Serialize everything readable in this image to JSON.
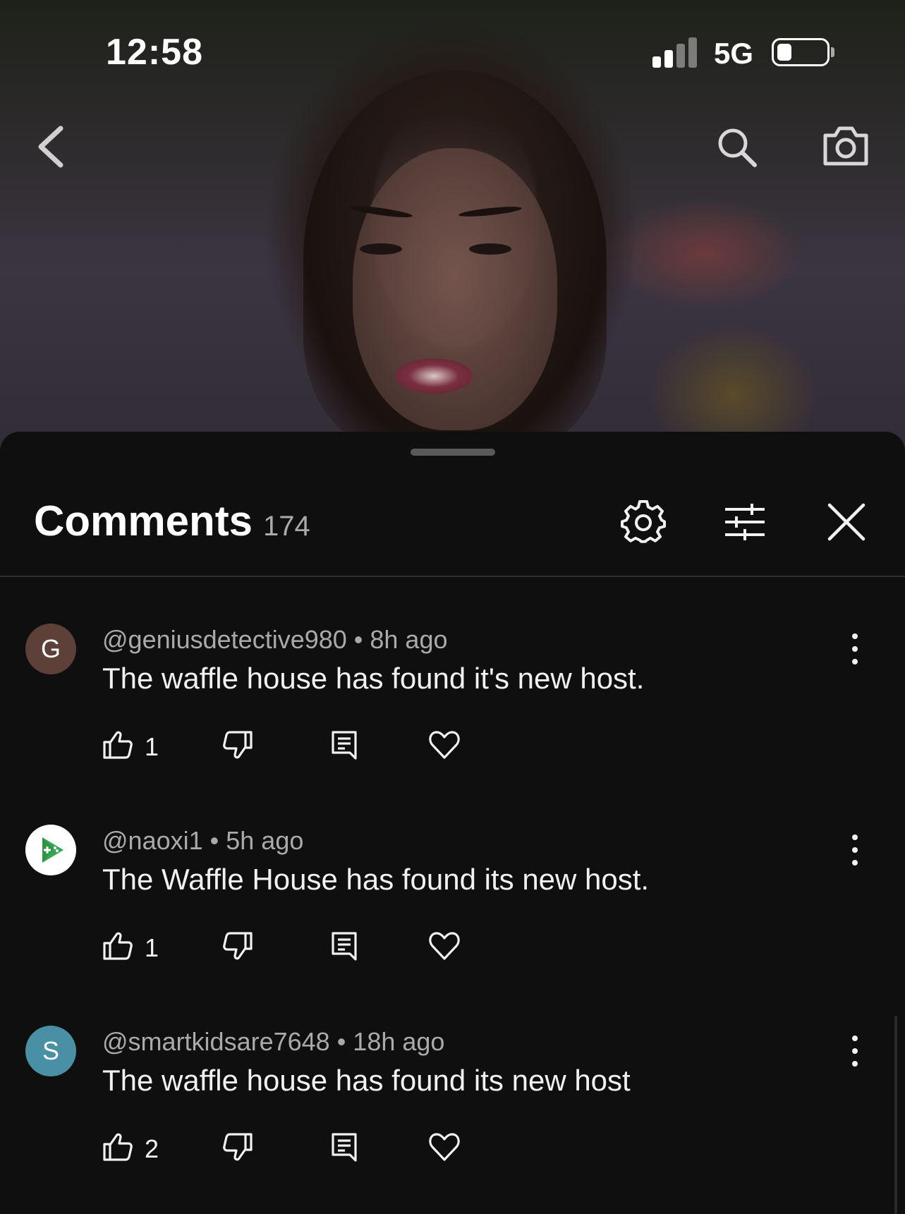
{
  "status_bar": {
    "time": "12:58",
    "network": "5G",
    "signal_bars_active": 2,
    "signal_bars_total": 4,
    "battery_level": 0.3
  },
  "video_header": {
    "back_icon": "chevron-left-icon",
    "search_icon": "search-icon",
    "camera_icon": "camera-icon"
  },
  "comments_panel": {
    "title": "Comments",
    "count": "174",
    "icons": [
      "gear-icon",
      "filter-sliders-icon",
      "close-icon"
    ]
  },
  "comments": [
    {
      "avatar_letter": "G",
      "avatar_color": "#5d4037",
      "author": "@geniusdetective980",
      "time": "8h ago",
      "text": "The waffle house has found it's new host.",
      "likes": "1"
    },
    {
      "avatar_letter": "",
      "avatar_color": "#ffffff",
      "avatar_icon": "game-controller-logo-icon",
      "author": "@naoxi1",
      "time": "5h ago",
      "text": "The Waffle House has found its new host.",
      "likes": "1"
    },
    {
      "avatar_letter": "S",
      "avatar_color": "#4a90a4",
      "author": "@smartkidsare7648",
      "time": "18h ago",
      "text": "The waffle house has found its new host",
      "likes": "2"
    }
  ],
  "action_icons": [
    "thumbs-up-icon",
    "thumbs-down-icon",
    "reply-icon",
    "heart-icon"
  ],
  "colors": {
    "background": "#0f0f0f",
    "text_primary": "#f1f1f1",
    "text_secondary": "#aaaaaa"
  }
}
